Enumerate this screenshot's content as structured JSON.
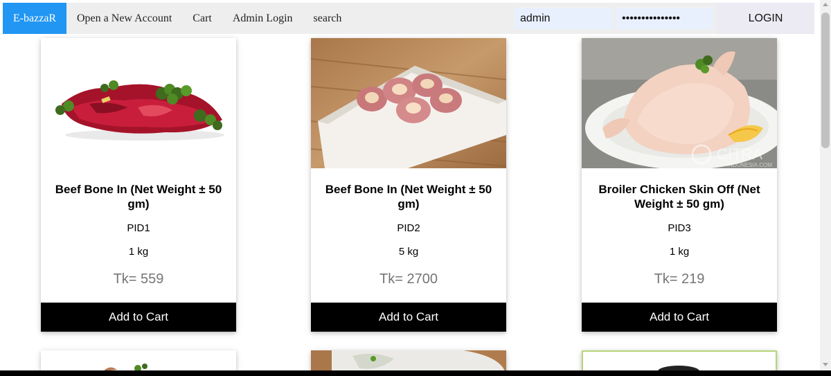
{
  "navbar": {
    "brand": "E-bazzaR",
    "links": [
      "Open a New Account",
      "Cart",
      "Admin Login",
      "search"
    ],
    "username_value": "admin",
    "password_value": "•••••••••••••••",
    "login_label": "LOGIN"
  },
  "products": [
    {
      "title": "Beef Bone In (Net Weight ± 50 gm)",
      "pid": "PID1",
      "weight": "1 kg",
      "price": "Tk= 559",
      "button": "Add to Cart",
      "image": "beef-meat-image"
    },
    {
      "title": "Beef Bone In (Net Weight ± 50 gm)",
      "pid": "PID2",
      "weight": "5 kg",
      "price": "Tk= 2700",
      "button": "Add to Cart",
      "image": "beef-bone-image"
    },
    {
      "title": "Broiler Chicken Skin Off (Net Weight ± 50 gm)",
      "pid": "PID3",
      "weight": "1 kg",
      "price": "Tk= 219",
      "button": "Add to Cart",
      "image": "chicken-image",
      "watermark": "CITRA",
      "watermark_sub": "INDONESIA.COM"
    }
  ],
  "colors": {
    "brand": "#2196f3",
    "button": "#000000",
    "price": "#757575"
  }
}
